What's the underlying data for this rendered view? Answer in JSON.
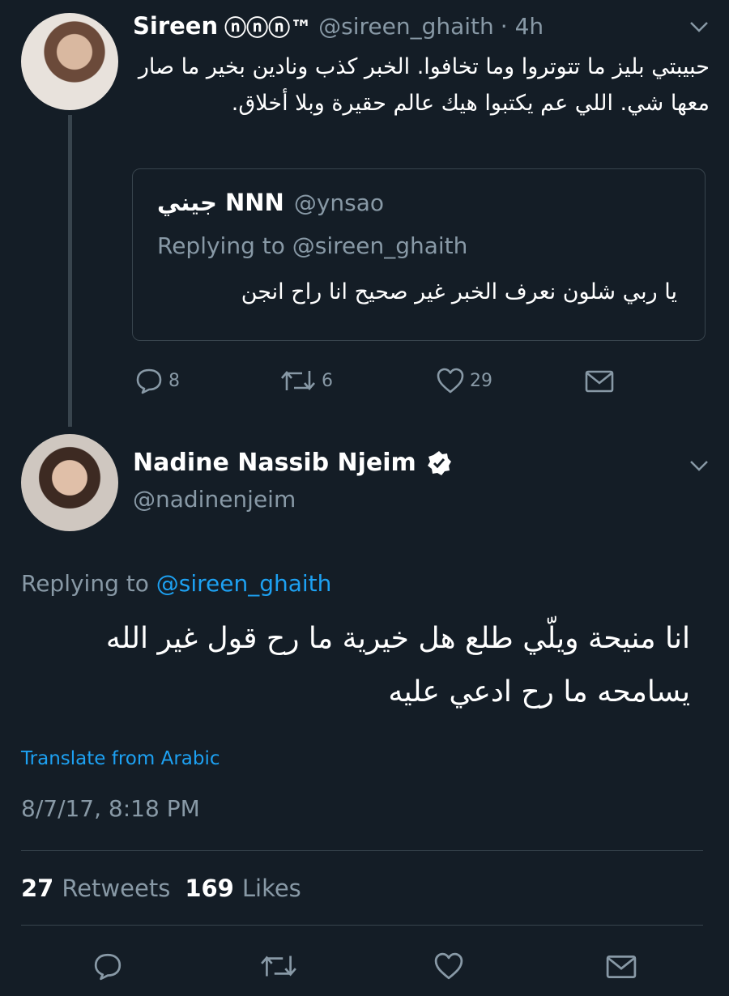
{
  "first_tweet": {
    "display_name": "Sireen",
    "name_badges": "ⓝⓝⓝ™",
    "handle": "@sireen_ghaith",
    "time": "· 4h",
    "text": "حبيبتي بليز ما تتوتروا وما تخافوا. الخبر كذب ونادين بخير ما صار معها شي. اللي عم يكتبوا هيك عالم حقيرة وبلا أخلاق.",
    "quoted": {
      "display_name": "جيني NNN",
      "handle": "@ynsao",
      "replying_prefix": "Replying to",
      "replying_handle": "@sireen_ghaith",
      "text": "يا ربي شلون نعرف الخبر غير صحيح انا راح انجن"
    },
    "actions": {
      "replies": "8",
      "retweets": "6",
      "likes": "29"
    }
  },
  "main_tweet": {
    "display_name": "Nadine Nassib Njeim",
    "handle": "@nadinenjeim",
    "replying_prefix": "Replying to",
    "replying_handle": "@sireen_ghaith",
    "text": "انا منيحة ويلّي طلع هل خيرية ما رح قول غير الله يسامحه ما رح ادعي عليه",
    "translate": "Translate from Arabic",
    "timestamp": "8/7/17, 8:18 PM",
    "retweet_count": "27",
    "retweet_label": "Retweets",
    "like_count": "169",
    "like_label": "Likes"
  },
  "colors": {
    "background": "#141d26",
    "muted": "#8899a6",
    "link": "#1da1f2",
    "divider": "#38444d"
  }
}
